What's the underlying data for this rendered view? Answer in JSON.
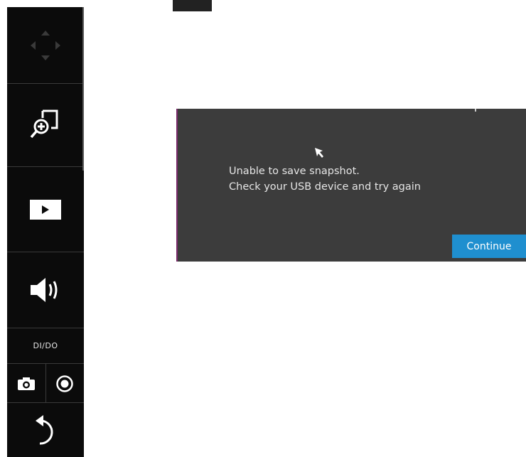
{
  "sidebar": {
    "ptz_icon": "ptz-directional-pad-icon",
    "zoom_icon": "zoom-in-window-icon",
    "play_icon": "play-icon",
    "audio_icon": "speaker-icon",
    "dido_label": "DI/DO",
    "snapshot_icon": "camera-icon",
    "record_icon": "record-icon",
    "back_icon": "back-arrow-icon"
  },
  "dialog": {
    "message_line1": "Unable to save snapshot.",
    "message_line2": "Check your USB device and try again",
    "continue_label": "Continue",
    "accent_color": "#1f8fcf",
    "background_color": "#3c3c3c"
  },
  "cursor_icon": "mouse-pointer-icon"
}
